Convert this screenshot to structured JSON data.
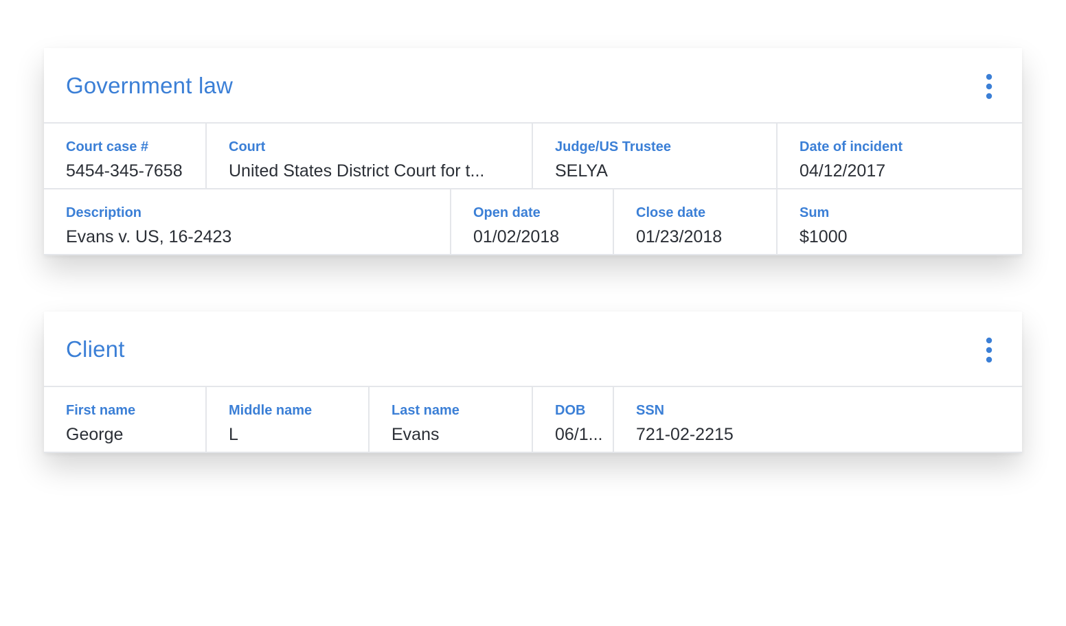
{
  "government_law": {
    "title": "Government law",
    "more_icon": "more-vert-icon",
    "row1": [
      {
        "label": "Court case #",
        "value": "5454-345-7658"
      },
      {
        "label": "Court",
        "value": "United States District Court for t..."
      },
      {
        "label": "Judge/US Trustee",
        "value": "SELYA"
      },
      {
        "label": "Date of incident",
        "value": "04/12/2017"
      }
    ],
    "row2": [
      {
        "label": "Description",
        "value": "Evans v. US, 16-2423"
      },
      {
        "label": "Open date",
        "value": "01/02/2018"
      },
      {
        "label": "Close date",
        "value": "01/23/2018"
      },
      {
        "label": "Sum",
        "value": "$1000"
      }
    ]
  },
  "client": {
    "title": "Client",
    "more_icon": "more-vert-icon",
    "row1": [
      {
        "label": "First name",
        "value": "George"
      },
      {
        "label": "Middle name",
        "value": "L"
      },
      {
        "label": "Last name",
        "value": "Evans"
      },
      {
        "label": "DOB",
        "value": "06/1..."
      },
      {
        "label": "SSN",
        "value": "721-02-2215"
      }
    ]
  },
  "colors": {
    "accent": "#3b7fd6",
    "text": "#2b2f36",
    "divider": "#e4e6ea"
  }
}
